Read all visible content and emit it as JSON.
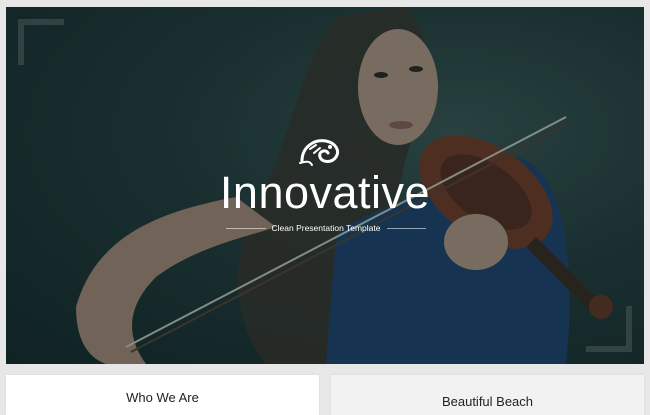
{
  "hero": {
    "title": "Innovative",
    "subtitle": "Clean Presentation Template",
    "logo_icon": "chameleon-logo-icon",
    "overlay_color": "#0e2e30"
  },
  "cards": [
    {
      "title": "Who We Are"
    },
    {
      "title": "Beautiful Beach"
    }
  ]
}
